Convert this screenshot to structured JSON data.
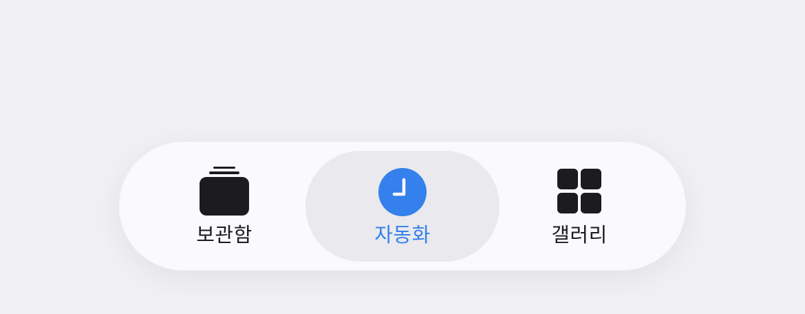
{
  "tab_bar": {
    "tabs": [
      {
        "label": "보관함",
        "icon": "library-stack-icon",
        "selected": false
      },
      {
        "label": "자동화",
        "icon": "clock-icon",
        "selected": true
      },
      {
        "label": "갤러리",
        "icon": "gallery-grid-icon",
        "selected": false
      }
    ]
  },
  "colors": {
    "background": "#f1f1f5",
    "bar": "#fafafd",
    "selected_pill": "#e9e9ee",
    "accent": "#3480ec",
    "icon_dark": "#1b1b20"
  }
}
